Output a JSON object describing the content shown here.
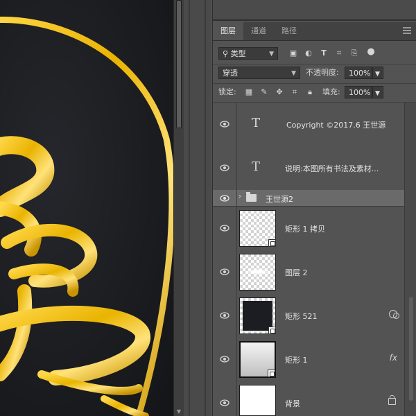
{
  "tabs": [
    {
      "label": "图层",
      "active": true
    },
    {
      "label": "通道",
      "active": false
    },
    {
      "label": "路径",
      "active": false
    }
  ],
  "filter": {
    "value": "类型",
    "icons": [
      "image-filter-icon",
      "adjustment-filter-icon",
      "type-filter-icon",
      "shape-filter-icon",
      "smart-object-filter-icon",
      "filter-toggle-icon"
    ]
  },
  "blend": {
    "mode": "穿透",
    "opacity_label": "不透明度:",
    "opacity_value": "100%"
  },
  "lock": {
    "label": "锁定:",
    "fill_label": "填充:",
    "fill_value": "100%"
  },
  "layers": [
    {
      "name": "Copyright ©2017.6  王世源",
      "kind": "type"
    },
    {
      "name": "说明:本图所有书法及素材...",
      "kind": "type"
    },
    {
      "name": "王世源2",
      "kind": "group"
    },
    {
      "name": "矩形 1 拷贝",
      "kind": "shape"
    },
    {
      "name": "图层 2",
      "kind": "pixel"
    },
    {
      "name": "矩形 521",
      "kind": "shape"
    },
    {
      "name": "矩形 1",
      "kind": "shape",
      "fx": "fx"
    },
    {
      "name": "背景",
      "kind": "background"
    }
  ],
  "colors": {
    "gold": "#f2c200",
    "panel": "#535353",
    "canvas": "#1c1d21"
  }
}
